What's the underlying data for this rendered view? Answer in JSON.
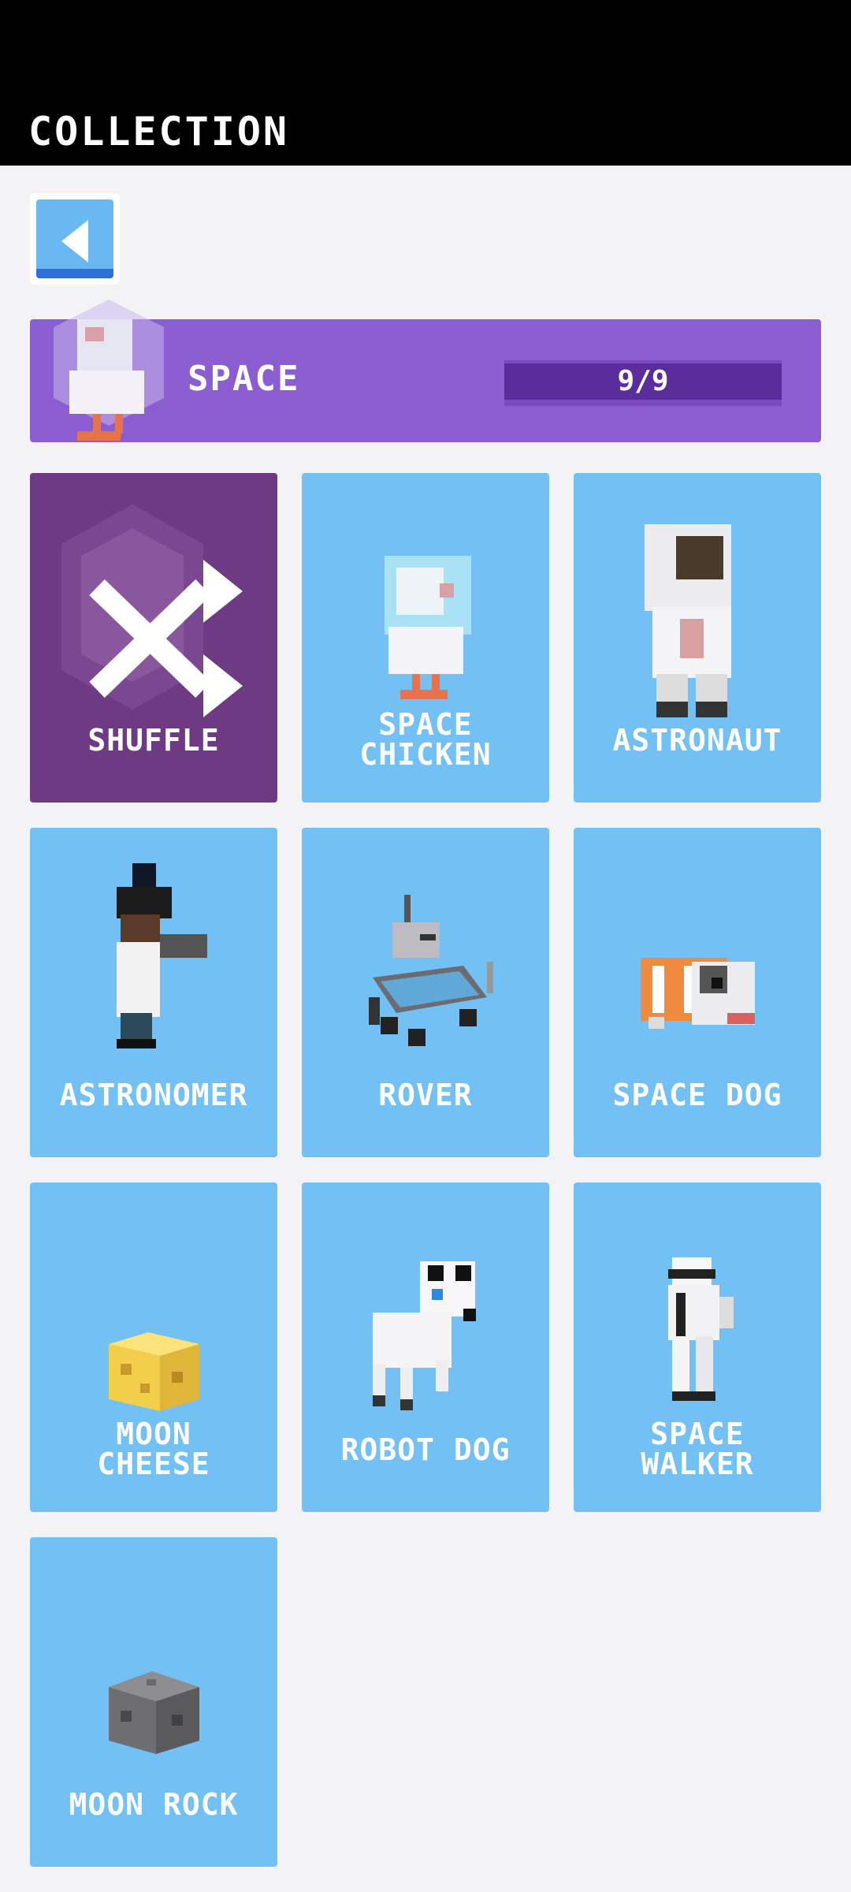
{
  "header": {
    "title": "COLLECTION"
  },
  "back_button": {
    "icon": "back-arrow-icon"
  },
  "category": {
    "name": "SPACE",
    "progress_text": "9/9",
    "progress": 1.0,
    "color": "#8a5ed0"
  },
  "cards": [
    {
      "label": "SHUFFLE",
      "icon": "shuffle-icon"
    },
    {
      "label": "SPACE\nCHICKEN"
    },
    {
      "label": "ASTRONAUT"
    },
    {
      "label": "ASTRONOMER"
    },
    {
      "label": "ROVER"
    },
    {
      "label": "SPACE DOG"
    },
    {
      "label": "MOON\nCHEESE"
    },
    {
      "label": "ROBOT DOG"
    },
    {
      "label": "SPACE\nWALKER"
    },
    {
      "label": "MOON ROCK"
    }
  ],
  "colors": {
    "card": "#73c0f4",
    "shuffle_card": "#6e3a84",
    "background": "#f3f3f5"
  }
}
